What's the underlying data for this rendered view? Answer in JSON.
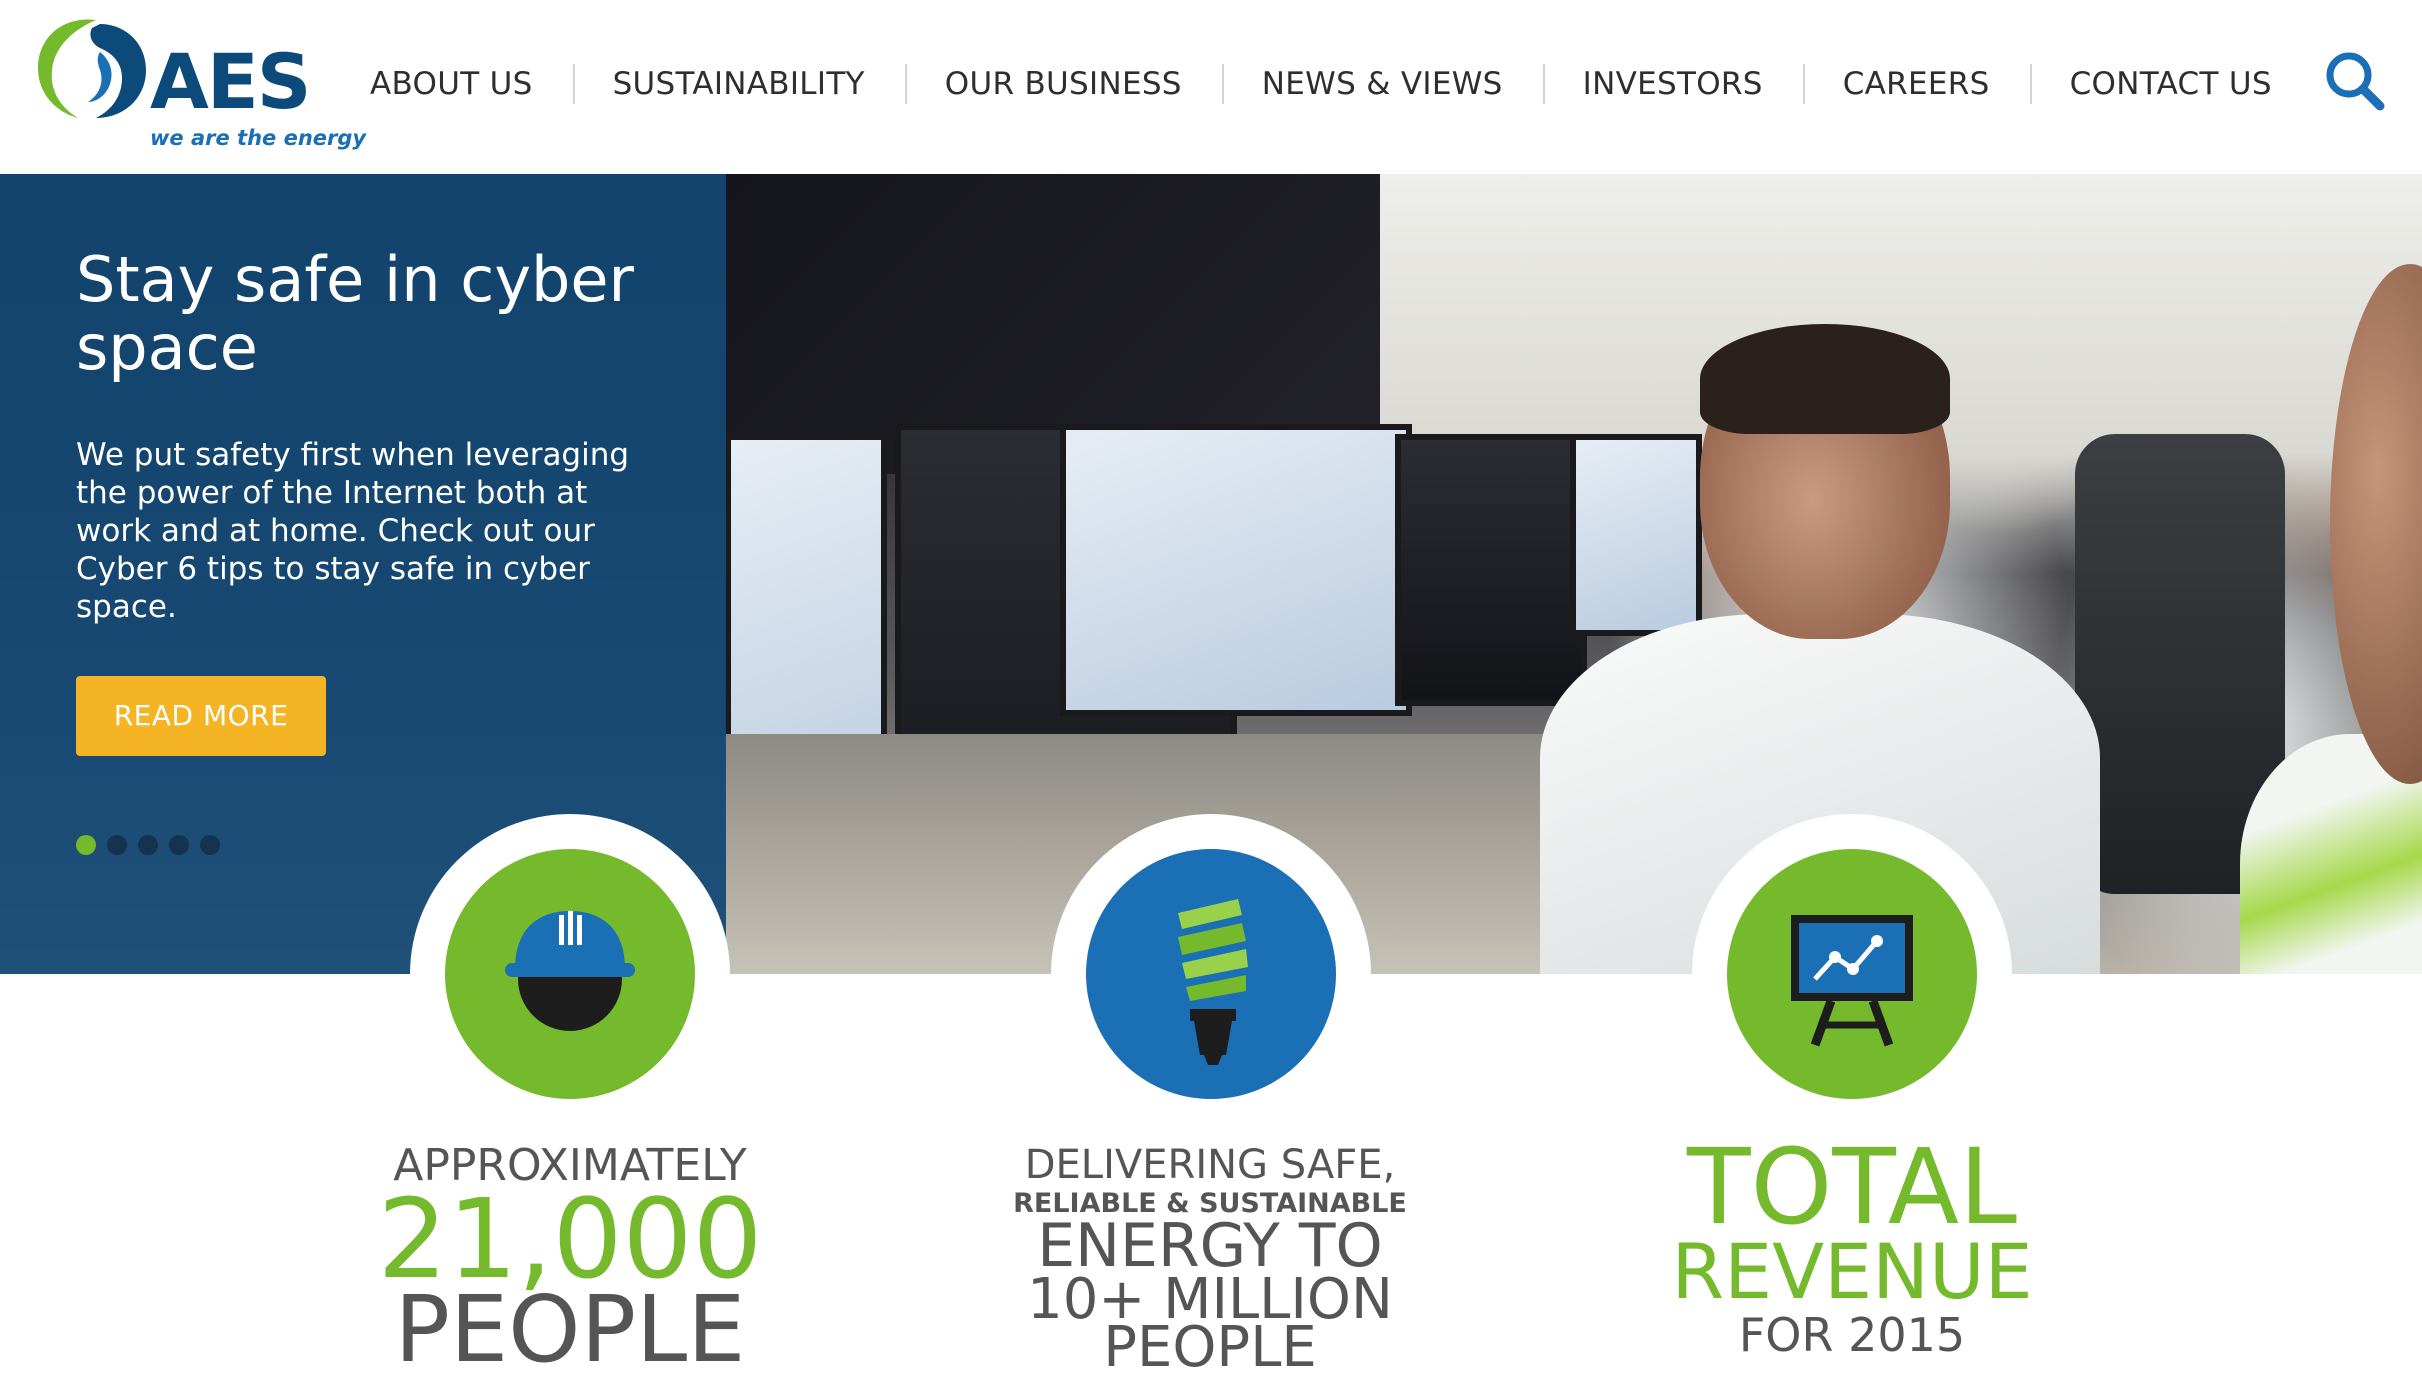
{
  "brand": {
    "name": "AES",
    "tagline": "we are the energy",
    "colors": {
      "navy": "#0c4a7a",
      "blue": "#1a6fb5",
      "green": "#75b92c",
      "yellow": "#f4b423"
    }
  },
  "nav": {
    "items": [
      {
        "label": "ABOUT US"
      },
      {
        "label": "SUSTAINABILITY"
      },
      {
        "label": "OUR BUSINESS"
      },
      {
        "label": "NEWS & VIEWS"
      },
      {
        "label": "INVESTORS"
      },
      {
        "label": "CAREERS"
      },
      {
        "label": "CONTACT US"
      }
    ],
    "search_icon": "search-icon"
  },
  "hero": {
    "title": "Stay safe in cyber space",
    "body": "We put safety first when leveraging the power of the Internet both at work and at home. Check out our Cyber 6 tips to stay safe in cyber space.",
    "cta_label": "READ MORE",
    "slide_count": 5,
    "active_slide": 1
  },
  "stats": [
    {
      "icon": "hard-hat-icon",
      "circle_color": "#75b92c",
      "line1": "APPROXIMATELY",
      "line2": "21,000",
      "line3": "PEOPLE"
    },
    {
      "icon": "light-bulb-icon",
      "circle_color": "#1a6fb5",
      "line1": "DELIVERING SAFE,",
      "line2": "RELIABLE & SUSTAINABLE",
      "line3": "ENERGY TO",
      "line4": "10+ MILLION",
      "line5": "PEOPLE"
    },
    {
      "icon": "chart-easel-icon",
      "circle_color": "#75b92c",
      "line1": "TOTAL",
      "line2": "REVENUE",
      "line3": "FOR 2015"
    }
  ]
}
